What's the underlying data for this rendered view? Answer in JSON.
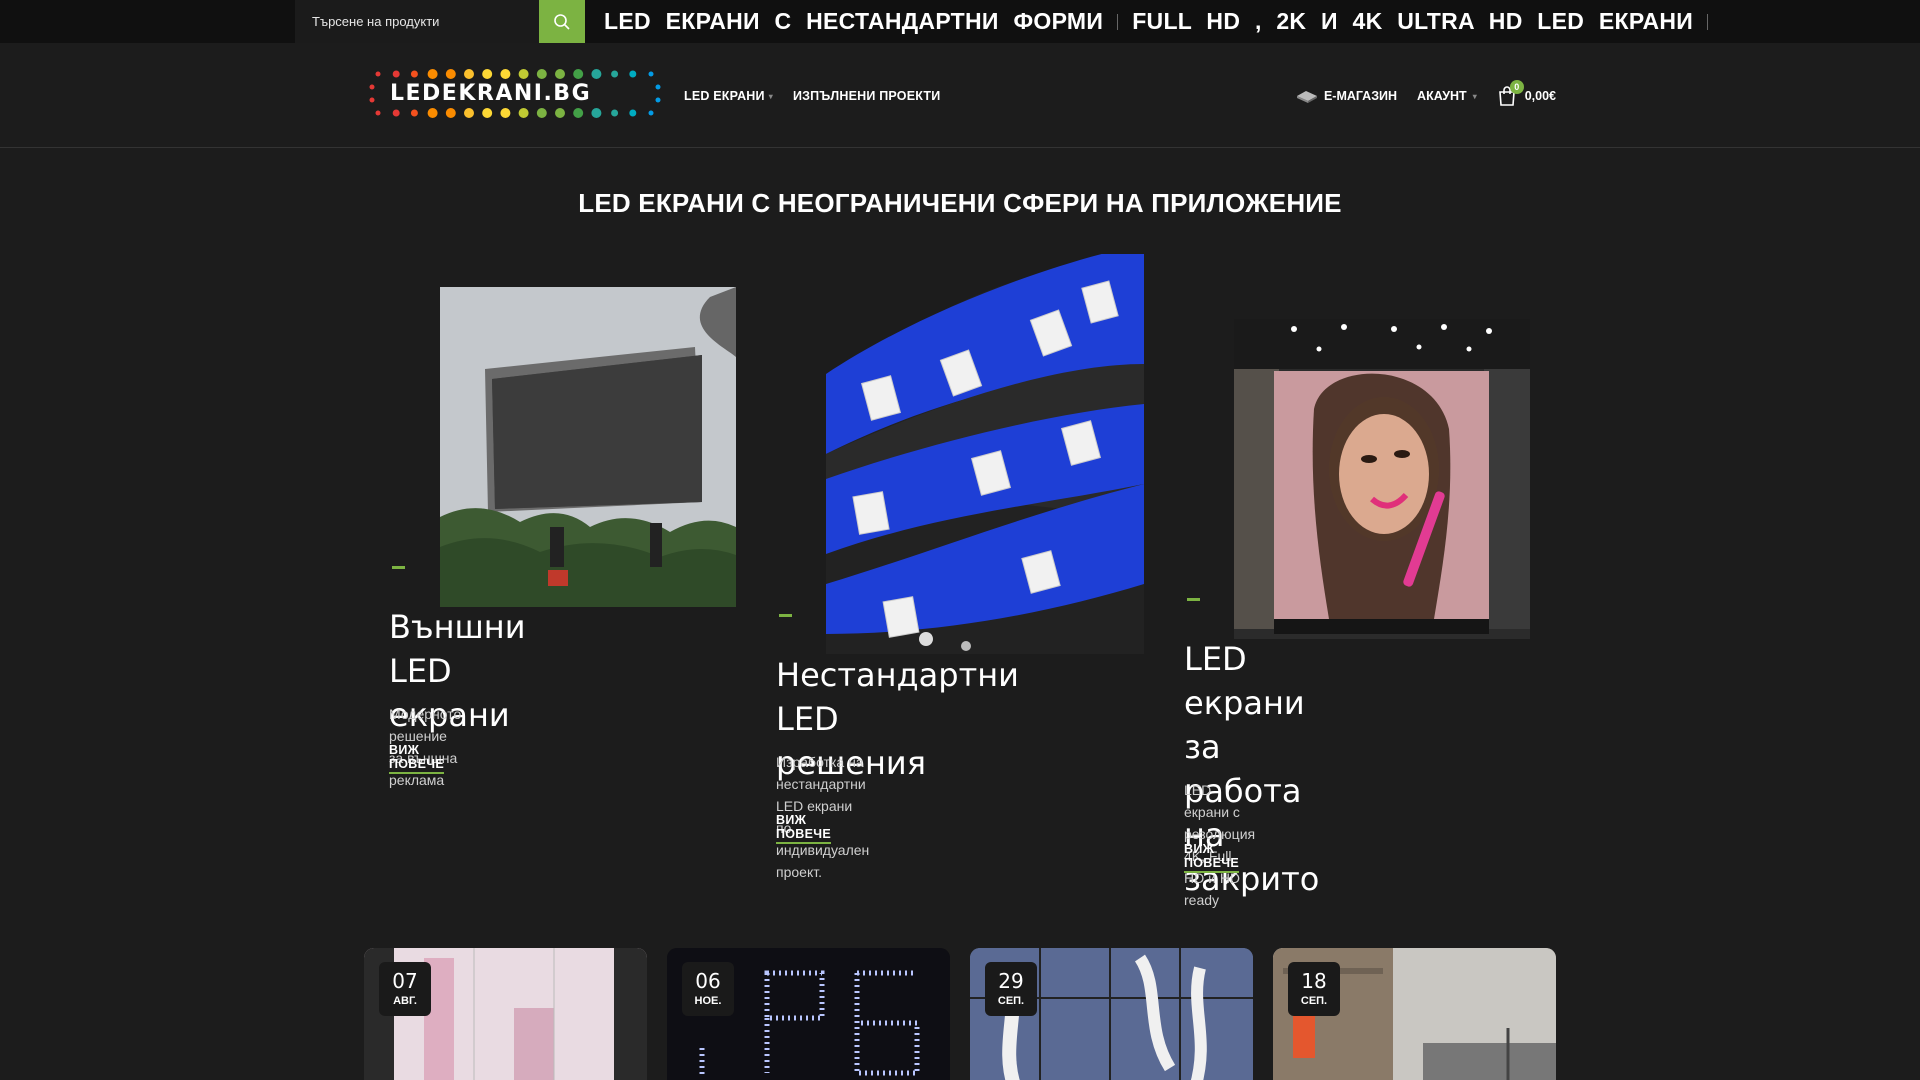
{
  "search": {
    "placeholder": "Търсене на продукти"
  },
  "marquee": {
    "text1": "LED ЕКРАНИ С НЕСТАНДАРТНИ ФОРМИ",
    "text2": "FULL HD , 2K И 4K ULTRA HD LED ЕКРАНИ"
  },
  "logo": {
    "text": "LEDEKRANI.BG"
  },
  "nav": {
    "items": [
      {
        "label": "LED ЕКРАНИ"
      },
      {
        "label": "ИЗПЪЛНЕНИ ПРОЕКТИ"
      }
    ]
  },
  "header_right": {
    "shop_label": "Е-МАГАЗИН",
    "account_label": "АКАУНТ",
    "cart_count": "0",
    "cart_total": "0,00€"
  },
  "section": {
    "title": "LED ЕКРАНИ С НЕОГРАНИЧЕНИ СФЕРИ НА ПРИЛОЖЕНИЕ"
  },
  "cards": [
    {
      "title_line1": "Външни LED",
      "title_line2": "екрани",
      "description": "Модерното решение за външна реклама",
      "link": "ВИЖ ПОВЕЧЕ"
    },
    {
      "title_line1": "Нестандартни LED",
      "title_line2": "решения",
      "description_line1": "Изработка на нестандартни LED екрани по",
      "description_line2": "индивидуален проект.",
      "link": "ВИЖ ПОВЕЧЕ"
    },
    {
      "title_line1": "LED екрани за",
      "title_line2": "работа на",
      "title_line3": "закрито",
      "description_line1": "LED екрани с резолюция 4K, Full HD и HD",
      "description_line2": "ready",
      "link": "ВИЖ ПОВЕЧЕ"
    }
  ],
  "posts": [
    {
      "day": "07",
      "month": "АВГ."
    },
    {
      "day": "06",
      "month": "НОЕ."
    },
    {
      "day": "29",
      "month": "СЕП."
    },
    {
      "day": "18",
      "month": "СЕП."
    }
  ],
  "colors": {
    "accent": "#7cb342",
    "background": "#1c1c1c",
    "topbar": "#101010"
  }
}
